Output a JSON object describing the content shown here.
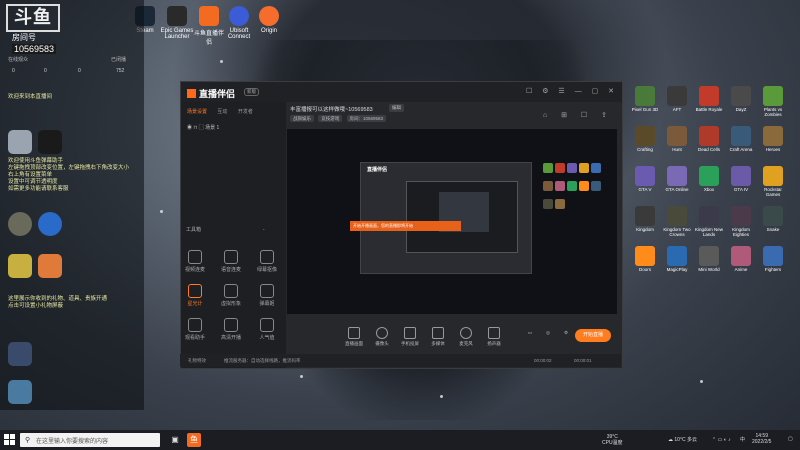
{
  "desktop_top_icons": [
    {
      "label": "Steam",
      "color": "#1b2838"
    },
    {
      "label": "Epic Games Launcher",
      "color": "#2a2a2a"
    },
    {
      "label": "斗鱼直播伴侣",
      "color": "#f36b21"
    },
    {
      "label": "Ubisoft Connect",
      "color": "#3b5cd6"
    },
    {
      "label": "Origin",
      "color": "#f56c2d"
    }
  ],
  "side_panel": {
    "logo": "斗鱼",
    "room_label": "房间号",
    "room_id": "10569583",
    "online_label": "在线观众",
    "status_label": "已闭播",
    "stats": [
      "0",
      "0",
      "0",
      "752"
    ],
    "welcome_text": "欢迎来到本直播间",
    "assistant_text": "欢迎使用斗鱼弹幕助手\n左键拖拽顶部改变位置，左键拖拽右下角改变大小\n右上角有设置菜单\n设置中可调节透明度\n如需更多功能请联系客服",
    "gift_text": "这里展示你收到的礼物、道具、贵族开通\n点击可设置小礼物屏蔽"
  },
  "window": {
    "app_name": "直播伴侣",
    "version": "新版",
    "left_tabs": [
      "场景设置",
      "互动",
      "开发者"
    ],
    "scene": "场景 1",
    "tools_header": "工具箱",
    "tools_more": "更多",
    "tools": [
      "视频连麦",
      "语音连麦",
      "绿幕抠像",
      "星光计",
      "虚拟形象",
      "弹幕姬",
      "观看助手",
      "高清开播",
      "人气值"
    ],
    "room_title": "丰富播报可以这样做哦~10569583",
    "edit_label": "编辑",
    "tags": [
      "战旗娱乐",
      "竞技游戏",
      "房间"
    ],
    "room_no_label": "房间：10569583",
    "preview_tip": "开始开播画面，您的直播即将开始",
    "bottom_tools": [
      "直播画面",
      "摄像头",
      "手机投屏",
      "多媒体",
      "麦克风",
      "扬声器"
    ],
    "start_label": "开始直播",
    "status_left": "礼物特效",
    "status_mid": "推流服务器：自动选择线路，推流码率",
    "status_time1": "00:00:02",
    "status_time2": "00:00:01",
    "status_fps": "CPU 0%"
  },
  "desktop_right_icons": [
    {
      "label": "Pixel Gun 3D",
      "color": "#4a7a3a"
    },
    {
      "label": "AFT",
      "color": "#3a3a3a"
    },
    {
      "label": "Battle Royale",
      "color": "#c23a2a"
    },
    {
      "label": "DayZ",
      "color": "#4a4a4a"
    },
    {
      "label": "Plants vs Zombies",
      "color": "#5a9a3a"
    },
    {
      "label": "Crafting",
      "color": "#5a4a2a"
    },
    {
      "label": "Hunt",
      "color": "#7a5a3a"
    },
    {
      "label": "Dead Cells",
      "color": "#b03a2a"
    },
    {
      "label": "Craft Arena",
      "color": "#3a5a7a"
    },
    {
      "label": "Heroes",
      "color": "#8a6a3a"
    },
    {
      "label": "GTA V",
      "color": "#6a5ab0"
    },
    {
      "label": "GTA Online",
      "color": "#7a6ab5"
    },
    {
      "label": "Xbox",
      "color": "#2aa05a"
    },
    {
      "label": "GTA IV",
      "color": "#6a5aa8"
    },
    {
      "label": "Rockstar Games",
      "color": "#e0a020"
    },
    {
      "label": "Kingdom",
      "color": "#3a3a3a"
    },
    {
      "label": "Kingdom Two Crowns",
      "color": "#4a4a3a"
    },
    {
      "label": "Kingdom New Lands",
      "color": "#3a3a4a"
    },
    {
      "label": "Kingdom Eighties",
      "color": "#4a3a4a"
    },
    {
      "label": "Snake",
      "color": "#3a4a4a"
    },
    {
      "label": "Doors",
      "color": "#ff8c1a"
    },
    {
      "label": "MagicPlay",
      "color": "#2a6ab0"
    },
    {
      "label": "Mini World",
      "color": "#5a5a5a"
    },
    {
      "label": "Anime",
      "color": "#b05a7a"
    },
    {
      "label": "Fighters",
      "color": "#3a6ab0"
    }
  ],
  "taskbar": {
    "search_placeholder": "在这里输入你要搜索的内容",
    "cpu_temp": "39°C",
    "cpu_label": "CPU温度",
    "weather": "10°C 多云",
    "lang": "中",
    "time": "14:59",
    "date": "2022/2/5"
  }
}
